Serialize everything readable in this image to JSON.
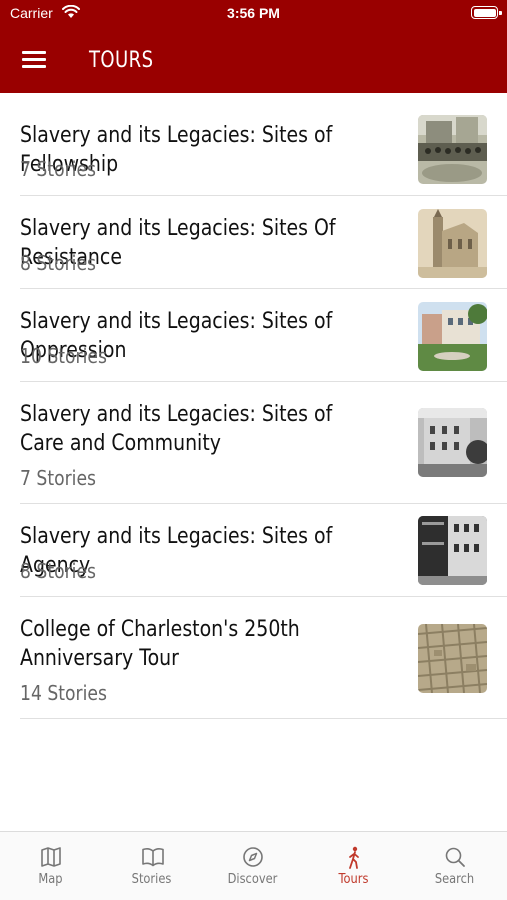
{
  "status_bar": {
    "carrier": "Carrier",
    "time": "3:56 PM"
  },
  "header": {
    "title": "TOURS"
  },
  "tours": [
    {
      "title": "Slavery and its Legacies: Sites of Fellowship",
      "subtitle": "7 Stories"
    },
    {
      "title": "Slavery and its Legacies: Sites Of Resistance",
      "subtitle": "8 Stories"
    },
    {
      "title": "Slavery and its Legacies: Sites of Oppression",
      "subtitle": "10 Stories"
    },
    {
      "title": "Slavery and its Legacies: Sites of Care and Community",
      "subtitle": "7 Stories"
    },
    {
      "title": "Slavery and its Legacies: Sites of Agency",
      "subtitle": "8 Stories"
    },
    {
      "title": "College of Charleston's 250th Anniversary Tour",
      "subtitle": "14 Stories"
    }
  ],
  "tabbar": {
    "tabs": [
      {
        "label": "Map",
        "icon": "map-icon"
      },
      {
        "label": "Stories",
        "icon": "book-icon"
      },
      {
        "label": "Discover",
        "icon": "compass-icon"
      },
      {
        "label": "Tours",
        "icon": "walking-person-icon",
        "active": true
      },
      {
        "label": "Search",
        "icon": "search-icon"
      }
    ]
  },
  "colors": {
    "brand": "#990000",
    "active_tab": "#c0392b",
    "inactive_tab": "#777777"
  }
}
